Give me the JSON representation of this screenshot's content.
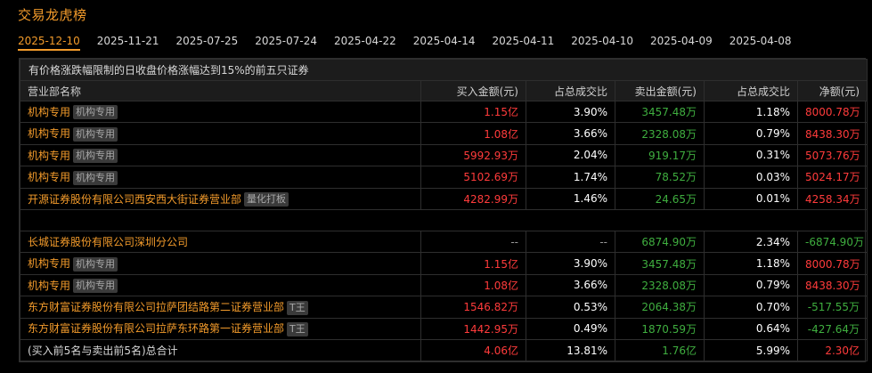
{
  "title": "交易龙虎榜",
  "dates": [
    "2025-12-10",
    "2025-11-21",
    "2025-07-25",
    "2025-07-24",
    "2025-04-22",
    "2025-04-14",
    "2025-04-11",
    "2025-04-10",
    "2025-04-09",
    "2025-04-08"
  ],
  "active_date_index": 0,
  "caption": "有价格涨跌幅限制的日收盘价格涨幅达到15%的前五只证券",
  "columns": [
    "营业部名称",
    "买入金额(元)",
    "占总成交比",
    "卖出金额(元)",
    "占总成交比",
    "净额(元)"
  ],
  "buy_rows": [
    {
      "name": "机构专用",
      "tag": "机构专用",
      "buy": "1.15亿",
      "buy_pct": "3.90%",
      "sell": "3457.48万",
      "sell_pct": "1.18%",
      "net": "8000.78万"
    },
    {
      "name": "机构专用",
      "tag": "机构专用",
      "buy": "1.08亿",
      "buy_pct": "3.66%",
      "sell": "2328.08万",
      "sell_pct": "0.79%",
      "net": "8438.30万"
    },
    {
      "name": "机构专用",
      "tag": "机构专用",
      "buy": "5992.93万",
      "buy_pct": "2.04%",
      "sell": "919.17万",
      "sell_pct": "0.31%",
      "net": "5073.76万"
    },
    {
      "name": "机构专用",
      "tag": "机构专用",
      "buy": "5102.69万",
      "buy_pct": "1.74%",
      "sell": "78.52万",
      "sell_pct": "0.03%",
      "net": "5024.17万"
    },
    {
      "name": "开源证券股份有限公司西安西大街证券营业部",
      "tag": "量化打板",
      "buy": "4282.99万",
      "buy_pct": "1.46%",
      "sell": "24.65万",
      "sell_pct": "0.01%",
      "net": "4258.34万"
    }
  ],
  "sell_rows": [
    {
      "name": "长城证券股份有限公司深圳分公司",
      "tag": "",
      "buy": "--",
      "buy_pct": "--",
      "sell": "6874.90万",
      "sell_pct": "2.34%",
      "net": "-6874.90万"
    },
    {
      "name": "机构专用",
      "tag": "机构专用",
      "buy": "1.15亿",
      "buy_pct": "3.90%",
      "sell": "3457.48万",
      "sell_pct": "1.18%",
      "net": "8000.78万"
    },
    {
      "name": "机构专用",
      "tag": "机构专用",
      "buy": "1.08亿",
      "buy_pct": "3.66%",
      "sell": "2328.08万",
      "sell_pct": "0.79%",
      "net": "8438.30万"
    },
    {
      "name": "东方财富证券股份有限公司拉萨团结路第二证券营业部",
      "tag": "T王",
      "buy": "1546.82万",
      "buy_pct": "0.53%",
      "sell": "2064.38万",
      "sell_pct": "0.70%",
      "net": "-517.55万"
    },
    {
      "name": "东方财富证券股份有限公司拉萨东环路第一证券营业部",
      "tag": "T王",
      "buy": "1442.95万",
      "buy_pct": "0.49%",
      "sell": "1870.59万",
      "sell_pct": "0.64%",
      "net": "-427.64万"
    }
  ],
  "total_row": {
    "label": "(买入前5名与卖出前5名)总合计",
    "buy": "4.06亿",
    "buy_pct": "13.81%",
    "sell": "1.76亿",
    "sell_pct": "5.99%",
    "net": "2.30亿"
  },
  "colors": {
    "accent": "#f39b2b",
    "up": "#ff3b3b",
    "down": "#3fae3f",
    "background": "#000000",
    "header_bg": "#1c1c1c"
  }
}
